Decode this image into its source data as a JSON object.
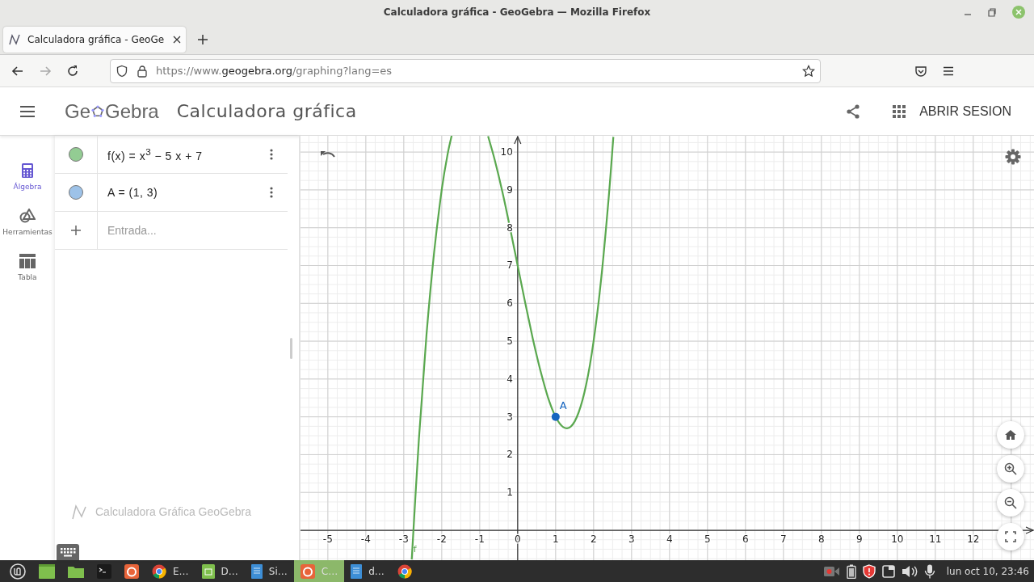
{
  "window": {
    "title": "Calculadora gráfica - GeoGebra — Mozilla Firefox"
  },
  "tabs": [
    {
      "label": "Calculadora gráfica - GeoGe",
      "selected": true
    }
  ],
  "address_bar": {
    "url": "https://www.**geogebra.org**/graphing?lang=es"
  },
  "app_header": {
    "logo_left": "Ge",
    "logo_right": "Gebra",
    "title": "Calculadora gráfica",
    "login": "ABRIR SESION"
  },
  "sidebar": {
    "items": [
      {
        "kind": "algebra",
        "label": "Álgebra",
        "selected": true
      },
      {
        "kind": "tools",
        "label": "Herramientas",
        "selected": false
      },
      {
        "kind": "table",
        "label": "Tabla",
        "selected": false
      }
    ]
  },
  "algebra": {
    "items": [
      {
        "expression": "f(x) = x$^{3}$ − 5 x + 7",
        "color": "#93cc93"
      },
      {
        "expression": "A = (1, 3)",
        "color": "#9dc2e8"
      }
    ],
    "input": {
      "placeholder": "Entrada..."
    },
    "footer": "Calculadora Gráfica GeoGebra"
  },
  "graph": {
    "chart_data": {
      "type": "line",
      "x": [
        -2.79,
        -2.6,
        -2.4,
        -2.2,
        -2.0,
        -1.85,
        -1.74,
        -1.2,
        -0.78,
        -0.6,
        -0.4,
        -0.2,
        0,
        0.2,
        0.4,
        0.6,
        0.8,
        1.0,
        1.2,
        1.4,
        1.6,
        1.8,
        2.0,
        2.2,
        2.4,
        2.52
      ],
      "series": [
        {
          "name": "f",
          "color": "#5aa84f",
          "values": [
            -0.77,
            2.42,
            5.18,
            7.35,
            9,
            9.92,
            10.43,
            null,
            10.42,
            9.78,
            8.94,
            7.99,
            7,
            6.01,
            5.06,
            4.22,
            3.51,
            3,
            2.73,
            2.74,
            3.1,
            3.83,
            5,
            6.65,
            8.82,
            10.4
          ]
        }
      ],
      "xlim": [
        -5.72,
        13.6
      ],
      "ylim": [
        -0.79,
        10.43
      ],
      "xticks": [
        -5,
        -4,
        -3,
        -2,
        -1,
        0,
        1,
        2,
        3,
        4,
        5,
        6,
        7,
        8,
        9,
        10,
        11,
        12
      ],
      "yticks": [
        1,
        2,
        3,
        4,
        5,
        6,
        7,
        8,
        9,
        10
      ],
      "grid": true,
      "annotations": [
        {
          "x": 1,
          "y": 3,
          "text": "A"
        }
      ]
    }
  },
  "taskbar": {
    "items": [
      {
        "kind": "menu",
        "selected": false
      },
      {
        "kind": "desktop",
        "selected": false
      },
      {
        "kind": "folder",
        "selected": false
      },
      {
        "kind": "terminal",
        "selected": false
      },
      {
        "kind": "firefox",
        "selected": false
      },
      {
        "kind": "chrome",
        "label": "E…",
        "selected": false
      },
      {
        "kind": "files",
        "label": "D…",
        "selected": false
      },
      {
        "kind": "doc",
        "label": "Si…",
        "selected": false
      },
      {
        "kind": "firefox",
        "label": "C…",
        "selected": true
      },
      {
        "kind": "doc",
        "label": "d…",
        "selected": false
      },
      {
        "kind": "chrome",
        "selected": false
      }
    ],
    "clock": "lun oct 10, 23:46"
  }
}
